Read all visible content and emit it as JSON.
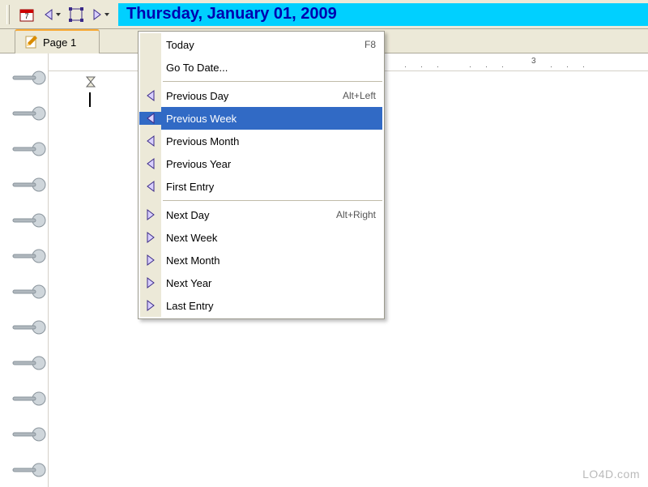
{
  "toolbar": {
    "date_text": "Thursday, January 01, 2009"
  },
  "tabs": {
    "page1_label": "Page 1"
  },
  "ruler": {
    "mark_3": "3"
  },
  "menu": {
    "today": {
      "label": "Today",
      "shortcut": "F8"
    },
    "goto": {
      "label": "Go To Date..."
    },
    "prev_day": {
      "label": "Previous Day",
      "shortcut": "Alt+Left"
    },
    "prev_week": {
      "label": "Previous Week"
    },
    "prev_month": {
      "label": "Previous Month"
    },
    "prev_year": {
      "label": "Previous Year"
    },
    "first_entry": {
      "label": "First Entry"
    },
    "next_day": {
      "label": "Next Day",
      "shortcut": "Alt+Right"
    },
    "next_week": {
      "label": "Next Week"
    },
    "next_month": {
      "label": "Next Month"
    },
    "next_year": {
      "label": "Next Year"
    },
    "last_entry": {
      "label": "Last Entry"
    }
  },
  "watermark": "LO4D.com"
}
